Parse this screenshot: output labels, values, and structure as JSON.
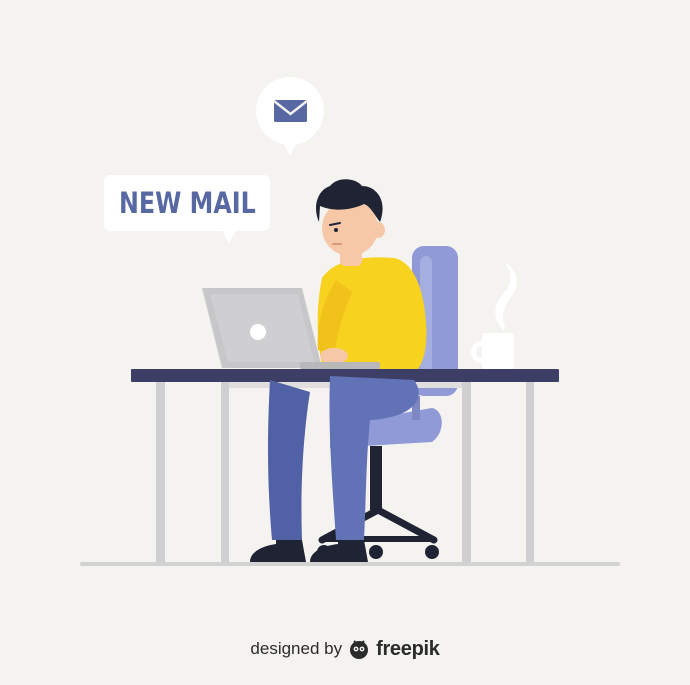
{
  "speech_bubble": {
    "text": "NEW MAIL"
  },
  "icons": {
    "notification": "envelope-icon",
    "brand_logo": "freepik-logo-icon"
  },
  "footer": {
    "designed_by": "designed by",
    "brand": "freepik"
  },
  "colors": {
    "background": "#f5f3f0",
    "accent_blue": "#5868a3",
    "shirt_yellow": "#f7d21e",
    "chair_blue": "#8f9ad6",
    "pants_blue": "#5d6cb0",
    "desk_top": "#3c3e66",
    "laptop_grey": "#c7c7c9"
  }
}
